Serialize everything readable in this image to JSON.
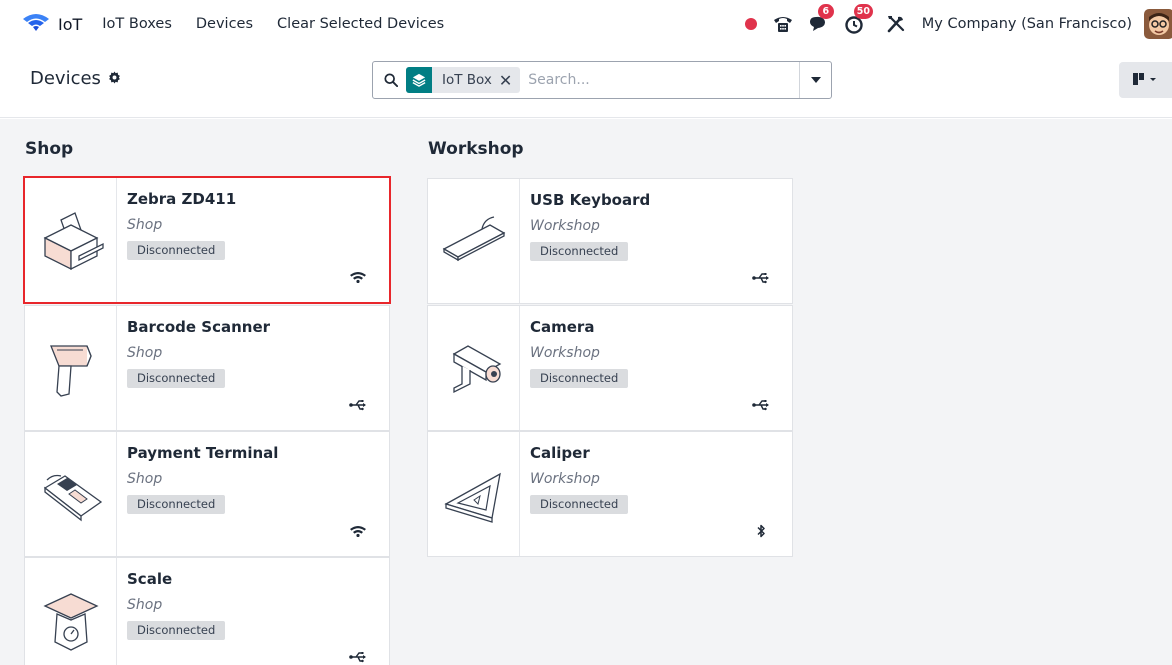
{
  "navbar": {
    "app_name": "IoT",
    "menu": [
      "IoT Boxes",
      "Devices",
      "Clear Selected Devices"
    ],
    "messages_count": "6",
    "activities_count": "50",
    "company": "My Company (San Francisco)",
    "icons": [
      "iot-wifi-icon",
      "record-dot-icon",
      "phone-icon",
      "chat-icon",
      "clock-icon",
      "tools-icon",
      "avatar"
    ]
  },
  "control_panel": {
    "title": "Devices",
    "facet_label": "IoT Box",
    "search_placeholder": "Search..."
  },
  "groups": [
    {
      "title": "Shop",
      "devices": [
        {
          "name": "Zebra ZD411",
          "location": "Shop",
          "status": "Disconnected",
          "connection": "wifi",
          "icon": "printer-icon",
          "selected": true
        },
        {
          "name": "Barcode Scanner",
          "location": "Shop",
          "status": "Disconnected",
          "connection": "usb",
          "icon": "barcode-scanner-icon",
          "selected": false
        },
        {
          "name": "Payment Terminal",
          "location": "Shop",
          "status": "Disconnected",
          "connection": "wifi",
          "icon": "payment-terminal-icon",
          "selected": false
        },
        {
          "name": "Scale",
          "location": "Shop",
          "status": "Disconnected",
          "connection": "usb",
          "icon": "scale-icon",
          "selected": false
        }
      ]
    },
    {
      "title": "Workshop",
      "devices": [
        {
          "name": "USB Keyboard",
          "location": "Workshop",
          "status": "Disconnected",
          "connection": "usb",
          "icon": "keyboard-icon",
          "selected": false
        },
        {
          "name": "Camera",
          "location": "Workshop",
          "status": "Disconnected",
          "connection": "usb",
          "icon": "camera-icon",
          "selected": false
        },
        {
          "name": "Caliper",
          "location": "Workshop",
          "status": "Disconnected",
          "connection": "bluetooth",
          "icon": "caliper-icon",
          "selected": false
        }
      ]
    }
  ],
  "colors": {
    "accent": "#017e84",
    "selection": "#e8262b",
    "badge": "#e0334c",
    "record": "#e0334c",
    "status_bg": "#dadcdf",
    "kanban_bg": "#f3f4f6",
    "device_fill": "#f7dcd3"
  }
}
